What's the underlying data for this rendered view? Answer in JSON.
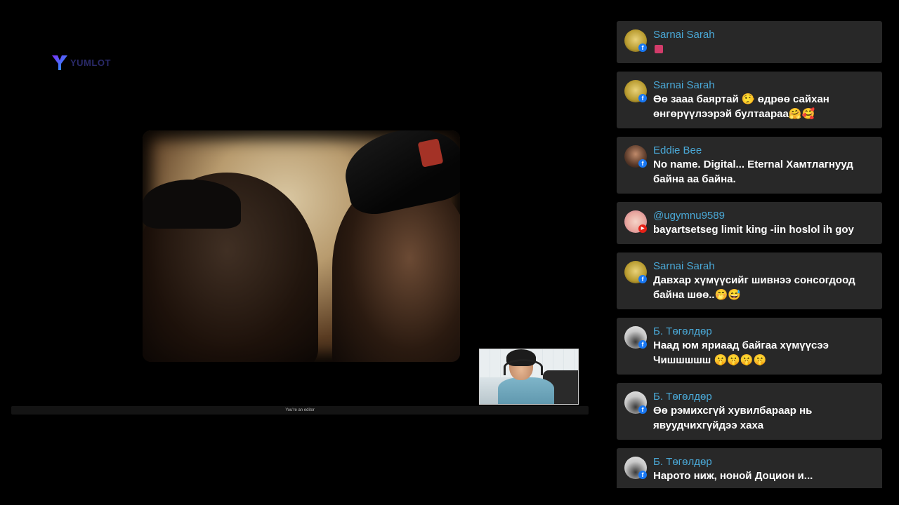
{
  "logo": {
    "text": "YUMLOT"
  },
  "editor_bar": {
    "label": "You're an editor"
  },
  "chat": {
    "messages": [
      {
        "author": "Sarnai Sarah",
        "text": "",
        "platform": "facebook",
        "avatar": "yellow",
        "emoji": "small"
      },
      {
        "author": "Sarnai Sarah",
        "text": "Өө зааа баяртай 🤥 өдрөө сайхан өнгөрүүлээрэй бултаараа🤗🥰",
        "platform": "facebook",
        "avatar": "yellow"
      },
      {
        "author": "Eddie Bee",
        "text": "No name. Digital... Eternal Хамтлагнууд байна аа байна.",
        "platform": "facebook",
        "avatar": "dark"
      },
      {
        "author": "@ugymnu9589",
        "text": "bayartsetseg limit king -iin hoslol ih goy",
        "platform": "youtube",
        "avatar": "anime"
      },
      {
        "author": "Sarnai Sarah",
        "text": "Давхар хүмүүсийг шивнээ сонсогдоод байна шөө..🤭😅",
        "platform": "facebook",
        "avatar": "yellow"
      },
      {
        "author": "Б. Төгөлдөр",
        "text": "Наад юм яриаад байгаа хүмүүсээ Чишшшшш 🤫🤫🤫🤫",
        "platform": "facebook",
        "avatar": "gray"
      },
      {
        "author": "Б. Төгөлдөр",
        "text": "Өө рэмихсгүй хувилбараар нь явуудчихгүйдээ хаха",
        "platform": "facebook",
        "avatar": "gray"
      },
      {
        "author": "Б. Төгөлдөр",
        "text": "Нарото ниж, ноной Доцион и... ",
        "platform": "facebook",
        "avatar": "gray"
      }
    ]
  }
}
